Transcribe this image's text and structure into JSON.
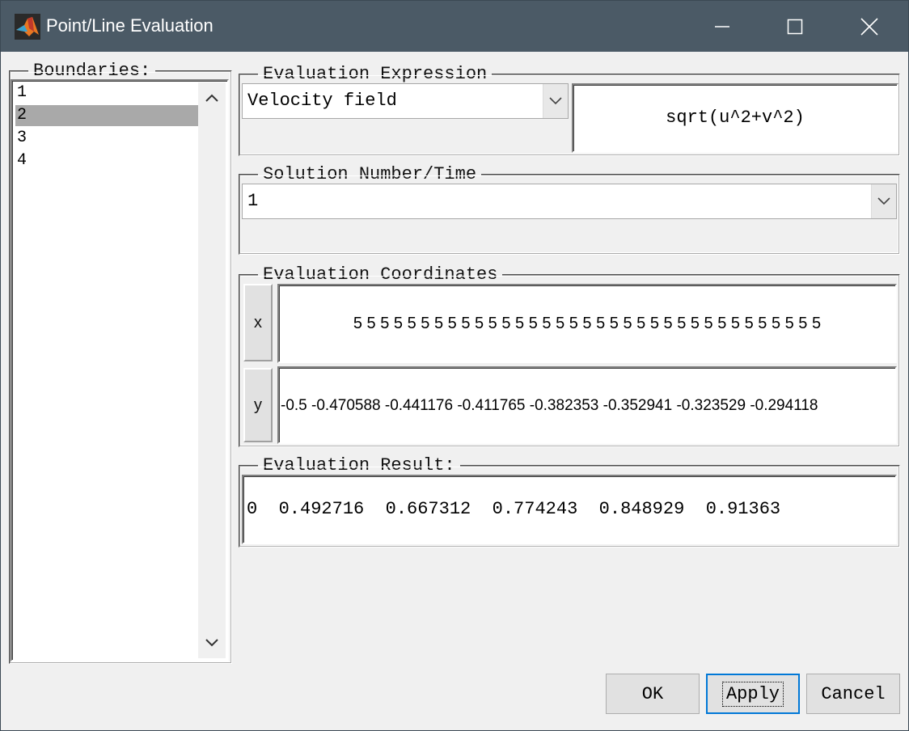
{
  "window": {
    "title": "Point/Line Evaluation"
  },
  "boundaries": {
    "label": "Boundaries:",
    "items": [
      "1",
      "2",
      "3",
      "4"
    ],
    "selected": "2"
  },
  "evaluation_expression": {
    "label": "Evaluation Expression",
    "selected_option": "Velocity field",
    "expression": "sqrt(u^2+v^2)"
  },
  "solution": {
    "label": "Solution Number/Time",
    "selected_option": "1"
  },
  "coordinates": {
    "label": "Evaluation Coordinates",
    "x_label": "x",
    "y_label": "y",
    "x_value": "5 5 5 5 5 5 5 5 5 5 5 5 5 5 5 5 5 5 5 5 5 5 5 5 5 5 5 5 5 5 5 5 5 5 5",
    "y_value": "-0.5 -0.470588 -0.441176 -0.411765 -0.382353 -0.352941 -0.323529 -0.294118"
  },
  "result": {
    "label": "Evaluation Result:",
    "value": "0  0.492716  0.667312  0.774243  0.848929  0.91363"
  },
  "buttons": {
    "ok": "OK",
    "apply": "Apply",
    "cancel": "Cancel"
  }
}
